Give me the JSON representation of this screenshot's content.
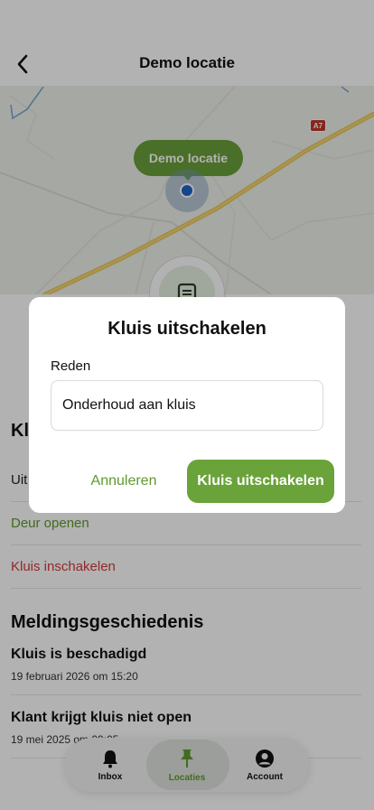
{
  "header": {
    "title": "Demo locatie",
    "back_icon": "chevron-left-icon"
  },
  "map": {
    "location_label": "Demo locatie",
    "road_badge": "A7"
  },
  "actions_section": {
    "title_partial": "Kl",
    "items": [
      {
        "label": "Uit",
        "color": "#222222"
      },
      {
        "label": "Deur openen",
        "color": "#5f9a2e"
      },
      {
        "label": "Kluis inschakelen",
        "color": "#d43a3a"
      }
    ]
  },
  "history": {
    "title": "Meldingsgeschiedenis",
    "items": [
      {
        "title": "Kluis is beschadigd",
        "date": "19 februari 2026 om 15:20"
      },
      {
        "title": "Klant krijgt kluis niet open",
        "date": "19 mei 2025 om 09:05"
      }
    ]
  },
  "bottom_nav": {
    "items": [
      {
        "label": "Inbox",
        "icon": "bell-icon"
      },
      {
        "label": "Locaties",
        "icon": "pin-icon",
        "active": true
      },
      {
        "label": "Account",
        "icon": "user-circle-icon"
      }
    ]
  },
  "modal": {
    "title": "Kluis uitschakelen",
    "field_label": "Reden",
    "field_value": "Onderhoud aan kluis",
    "cancel_label": "Annuleren",
    "confirm_label": "Kluis uitschakelen"
  },
  "colors": {
    "brand_green": "#6aa33a",
    "danger_red": "#d43a3a",
    "location_blue": "#1f63c6"
  }
}
